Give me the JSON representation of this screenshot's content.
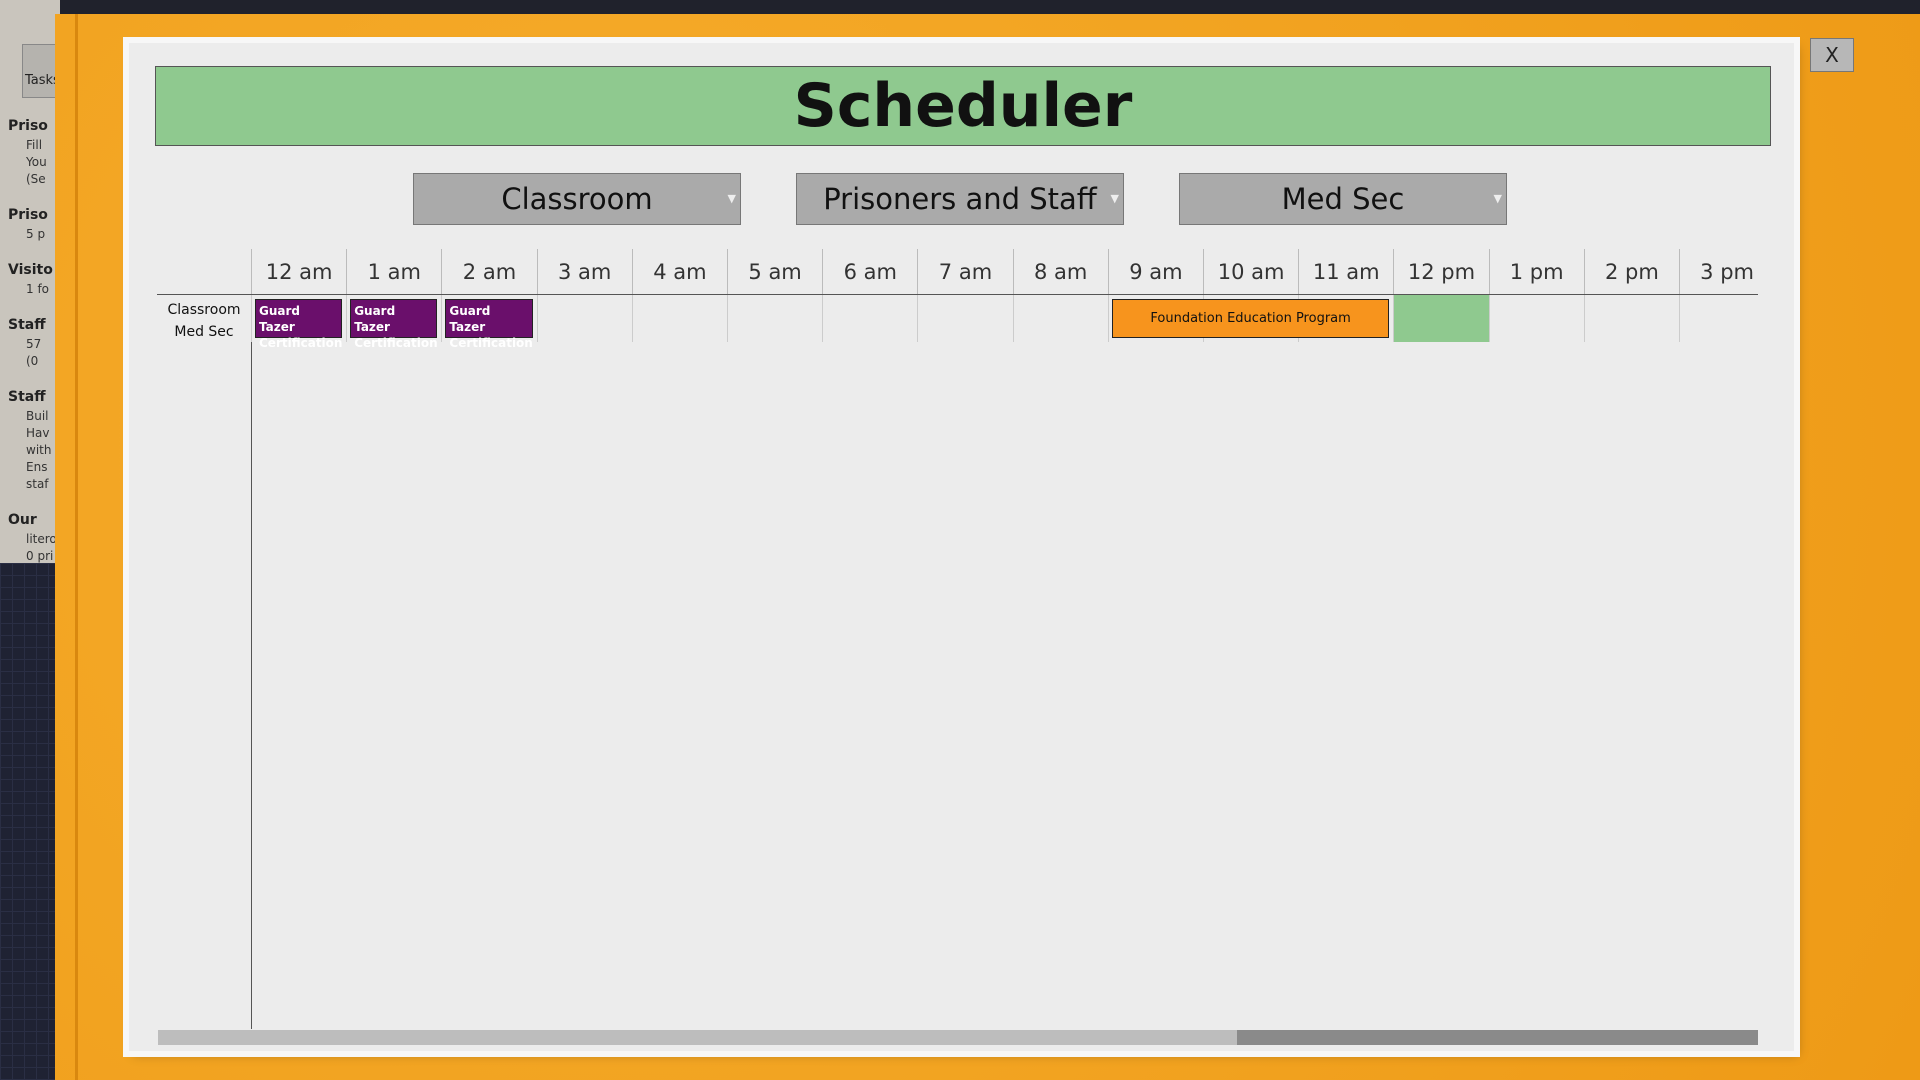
{
  "sidebar": {
    "tab": "Tasks",
    "items": [
      {
        "label": "Priso",
        "subs": [
          "Fill",
          "You",
          "(Se"
        ]
      },
      {
        "label": "Priso",
        "subs": [
          "5 p"
        ]
      },
      {
        "label": "Visito",
        "subs": [
          "1 fo"
        ]
      },
      {
        "label": "Staff",
        "subs": [
          "57",
          "(0"
        ]
      },
      {
        "label": "Staff",
        "subs": [
          "Buil",
          "Hav",
          "with",
          "Ens",
          "staf"
        ]
      },
      {
        "label": "Our",
        "subs": [
          "litero",
          "0 pri"
        ]
      }
    ]
  },
  "scheduler": {
    "title": "Scheduler",
    "close_label": "X",
    "dropdowns": [
      {
        "value": "Classroom"
      },
      {
        "value": "Prisoners and Staff"
      },
      {
        "value": "Med Sec"
      }
    ],
    "hours": [
      "12 am",
      "1 am",
      "2 am",
      "3 am",
      "4 am",
      "5 am",
      "6 am",
      "7 am",
      "8 am",
      "9 am",
      "10 am",
      "11 am",
      "12 pm",
      "1 pm",
      "2 pm",
      "3 pm"
    ],
    "row": {
      "room": "Classroom",
      "sector": "Med Sec"
    },
    "events": [
      {
        "label": "Guard Tazer Certification",
        "start": 0,
        "end": 1,
        "color": "#6a0f6b"
      },
      {
        "label": "Guard Tazer Certification",
        "start": 1,
        "end": 2,
        "color": "#6a0f6b"
      },
      {
        "label": "Guard Tazer Certification",
        "start": 2,
        "end": 3,
        "color": "#6a0f6b"
      },
      {
        "label": "Foundation Education Program",
        "start": 9,
        "end": 12,
        "color": "#f7941d"
      }
    ],
    "current_hour": 12,
    "highlight_color": "#8fc98f"
  }
}
